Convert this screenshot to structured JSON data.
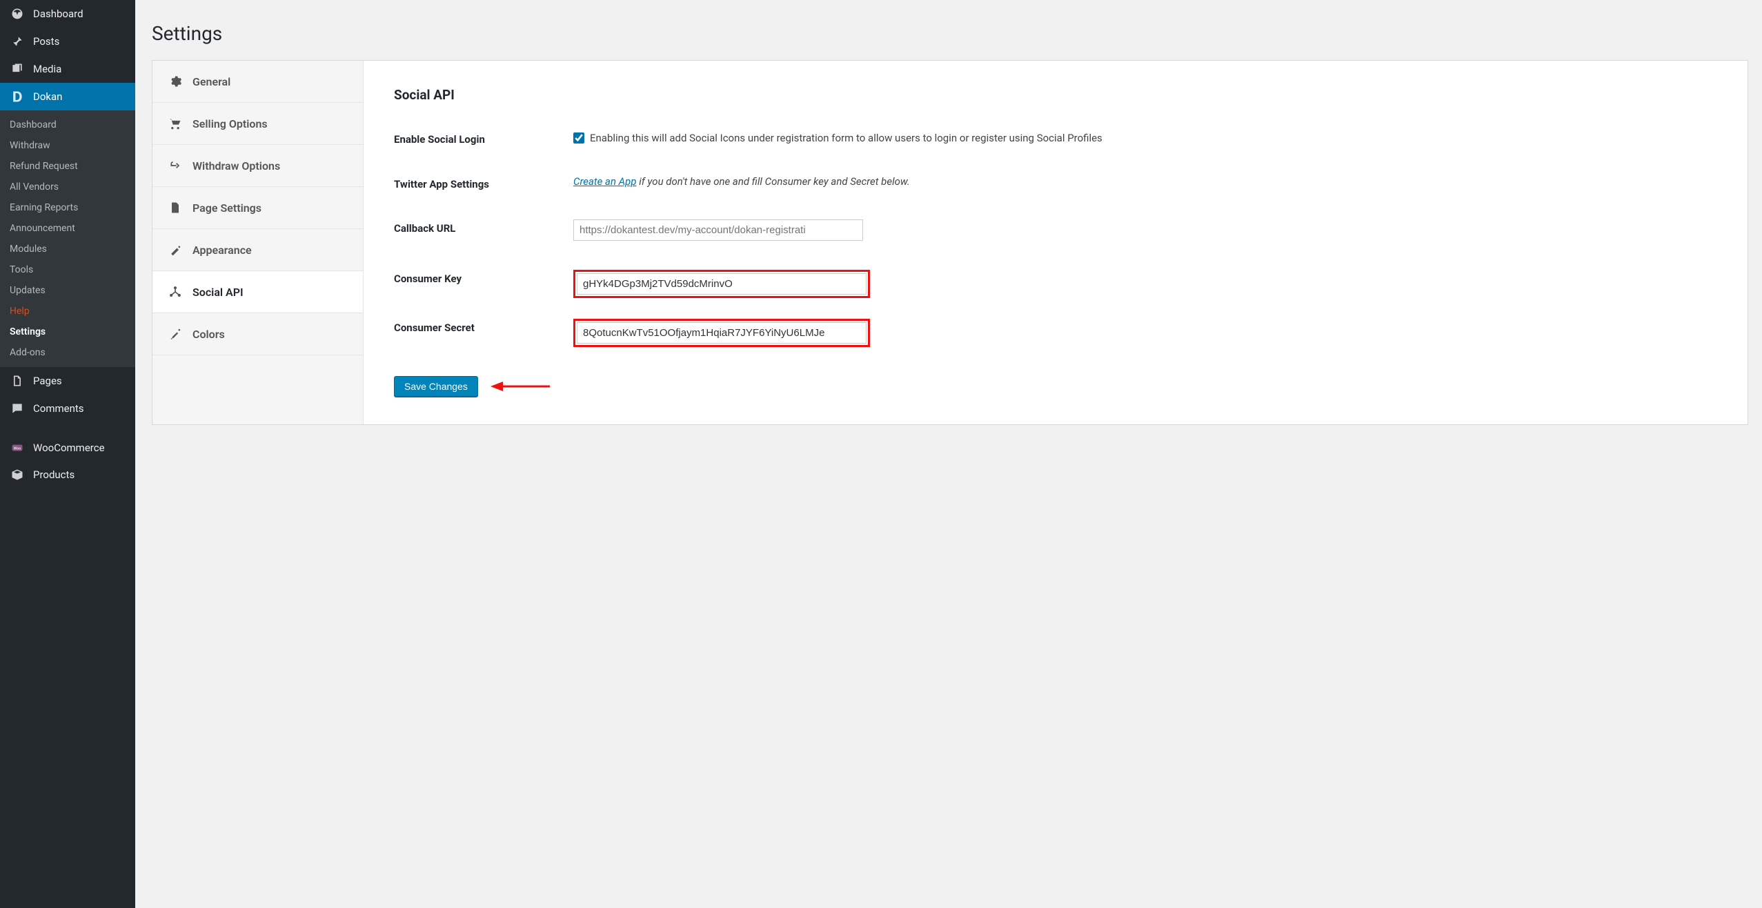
{
  "page": {
    "title": "Settings"
  },
  "sidebar": {
    "items": [
      {
        "label": "Dashboard"
      },
      {
        "label": "Posts"
      },
      {
        "label": "Media"
      },
      {
        "label": "Dokan"
      },
      {
        "label": "Pages"
      },
      {
        "label": "Comments"
      },
      {
        "label": "WooCommerce"
      },
      {
        "label": "Products"
      }
    ],
    "dokan_submenu": [
      "Dashboard",
      "Withdraw",
      "Refund Request",
      "All Vendors",
      "Earning Reports",
      "Announcement",
      "Modules",
      "Tools",
      "Updates",
      "Help",
      "Settings",
      "Add-ons"
    ]
  },
  "tabs": [
    {
      "label": "General"
    },
    {
      "label": "Selling Options"
    },
    {
      "label": "Withdraw Options"
    },
    {
      "label": "Page Settings"
    },
    {
      "label": "Appearance"
    },
    {
      "label": "Social API"
    },
    {
      "label": "Colors"
    }
  ],
  "panel": {
    "heading": "Social API",
    "enable_label": "Enable Social Login",
    "enable_desc": "Enabling this will add Social Icons under registration form to allow users to login or register using Social Profiles",
    "enable_checked": true,
    "twitter_label": "Twitter App Settings",
    "twitter_link_text": "Create an App",
    "twitter_hint": " if you don't have one and fill Consumer key and Secret below.",
    "callback_label": "Callback URL",
    "callback_placeholder": "https://dokantest.dev/my-account/dokan-registrati",
    "ckey_label": "Consumer Key",
    "ckey_value": "gHYk4DGp3Mj2TVd59dcMrinvO",
    "csecret_label": "Consumer Secret",
    "csecret_value": "8QotucnKwTv51OOfjaym1HqiaR7JYF6YiNyU6LMJe",
    "save_label": "Save Changes"
  }
}
